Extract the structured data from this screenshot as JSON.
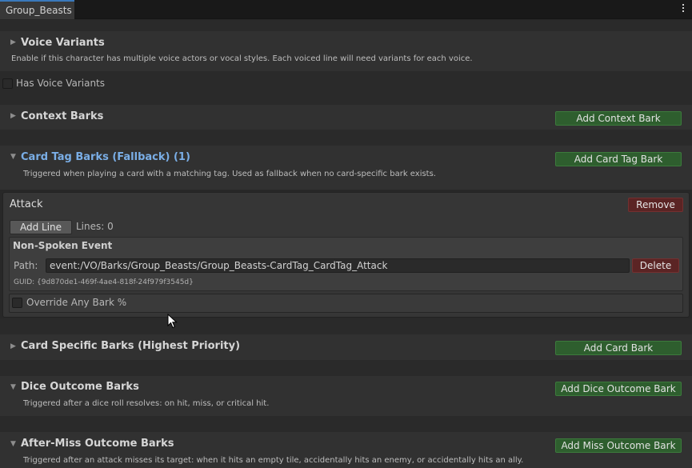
{
  "tab": {
    "label": "Group_Beasts"
  },
  "voice_variants": {
    "title": "Voice Variants",
    "description": "Enable if this character has multiple voice actors or vocal styles. Each voiced line will need variants for each voice.",
    "checkbox_label": "Has Voice Variants"
  },
  "context_barks": {
    "title": "Context Barks",
    "add_button": "Add Context Bark"
  },
  "card_tag_barks": {
    "title": "Card Tag Barks (Fallback) (1)",
    "add_button": "Add Card Tag Bark",
    "description": "Triggered when playing a card with a matching tag. Used as fallback when no card-specific bark exists.",
    "entry": {
      "name": "Attack",
      "remove_button": "Remove",
      "add_line_button": "Add Line",
      "lines_count": "Lines: 0",
      "event_title": "Non-Spoken Event",
      "path_label": "Path:",
      "path_value": "event:/VO/Barks/Group_Beasts/Group_Beasts-CardTag_CardTag_Attack",
      "delete_button": "Delete",
      "guid": "GUID: {9d870de1-469f-4ae4-818f-24f979f3545d}",
      "override_label": "Override Any Bark %"
    }
  },
  "card_specific_barks": {
    "title": "Card Specific Barks (Highest Priority)",
    "add_button": "Add Card Bark"
  },
  "dice_outcome_barks": {
    "title": "Dice Outcome Barks",
    "add_button": "Add Dice Outcome Bark",
    "description": "Triggered after a dice roll resolves: on hit, miss, or critical hit."
  },
  "after_miss_barks": {
    "title": "After-Miss Outcome Barks",
    "add_button": "Add Miss Outcome Bark",
    "description": "Triggered after an attack misses its target: when it hits an empty tile, accidentally hits an enemy, or accidentally hits an ally."
  },
  "icons": {
    "collapsed": "triangle-right",
    "expanded": "triangle-down",
    "menu": "kebab-menu-icon"
  },
  "colors": {
    "accent_blue": "#7aaee6",
    "green_button": "#2e5e2e",
    "red_button": "#5b2424"
  }
}
